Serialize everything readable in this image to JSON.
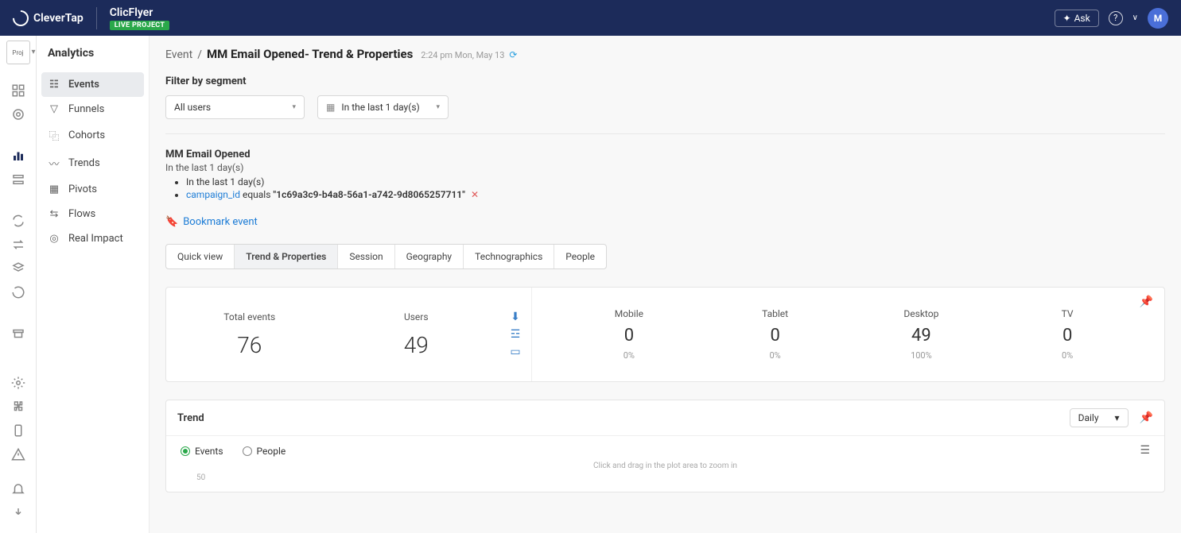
{
  "brand": "CleverTap",
  "project": {
    "name": "ClicFlyer",
    "badge": "LIVE PROJECT"
  },
  "topbar": {
    "ask_label": "Ask",
    "avatar_initial": "M"
  },
  "rail_proj": "Proj",
  "sidebar": {
    "title": "Analytics",
    "items": [
      "Events",
      "Funnels",
      "Cohorts",
      "Trends",
      "Pivots",
      "Flows",
      "Real Impact"
    ],
    "active_index": 0
  },
  "breadcrumb": {
    "root": "Event",
    "current": "MM Email Opened- Trend & Properties",
    "timestamp": "2:24 pm Mon, May 13"
  },
  "filter": {
    "label": "Filter by segment",
    "segment": "All users",
    "daterange": "In the last 1 day(s)"
  },
  "event": {
    "name": "MM Email Opened",
    "sub": "In the last 1 day(s)",
    "bullet1": "In the last 1 day(s)",
    "campaign_key": "campaign_id",
    "equals": "equals",
    "campaign_val": "\"1c69a3c9-b4a8-56a1-a742-9d8065257711\""
  },
  "bookmark_label": "Bookmark event",
  "tabs": [
    "Quick view",
    "Trend & Properties",
    "Session",
    "Geography",
    "Technographics",
    "People"
  ],
  "active_tab": 1,
  "stats": {
    "total_label": "Total events",
    "total_value": "76",
    "users_label": "Users",
    "users_value": "49",
    "platforms": [
      {
        "label": "Mobile",
        "value": "0",
        "pct": "0%"
      },
      {
        "label": "Tablet",
        "value": "0",
        "pct": "0%"
      },
      {
        "label": "Desktop",
        "value": "49",
        "pct": "100%"
      },
      {
        "label": "TV",
        "value": "0",
        "pct": "0%"
      }
    ]
  },
  "trend": {
    "title": "Trend",
    "granularity": "Daily",
    "radios": [
      "Events",
      "People"
    ],
    "zoom_hint": "Click and drag in the plot area to zoom in",
    "y_tick": "50"
  }
}
